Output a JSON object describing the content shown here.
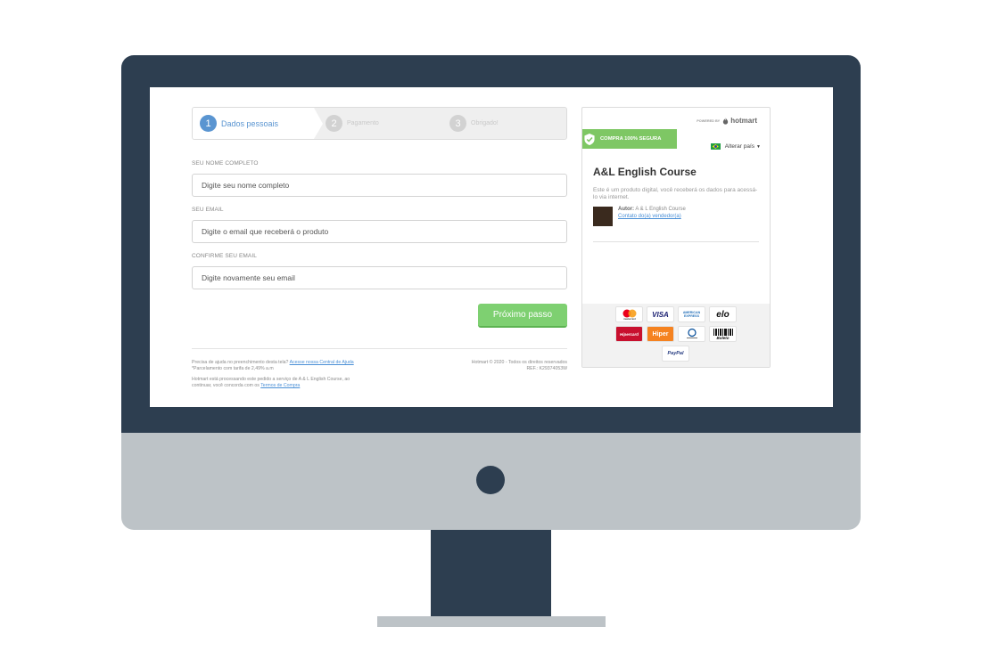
{
  "steps": [
    {
      "number": "1",
      "label": "Dados pessoais"
    },
    {
      "number": "2",
      "label": "Pagamento"
    },
    {
      "number": "3",
      "label": "Obrigado!"
    }
  ],
  "form": {
    "name": {
      "label": "SEU NOME COMPLETO",
      "placeholder": "Digite seu nome completo",
      "value": ""
    },
    "email": {
      "label": "SEU EMAIL",
      "placeholder": "Digite o email que receberá o produto",
      "value": ""
    },
    "confirm": {
      "label": "CONFIRME SEU EMAIL",
      "placeholder": "Digite novamente seu email",
      "value": ""
    },
    "next_button": "Próximo passo"
  },
  "footer": {
    "help_text": "Precisa de ajuda no preenchimento desta tela?",
    "help_link": "Acesse nossa Central de Ajuda",
    "installment_text": "*Parcelamento com tarifa de 2,49% a.m",
    "processing_text_1": "Hotmart está processando este pedido a serviço de A & L English Course, ao",
    "processing_text_2": "continuar, você concorda com os",
    "terms_link": "Termos de Compra",
    "copyright": "Hotmart © 2020 - Todos os direitos reservados",
    "ref": "REF.: K29374053W"
  },
  "product": {
    "powered_by": "POWERED BY",
    "brand": "hotmart",
    "secure_badge": "COMPRA 100% SEGURA",
    "change_country": "Alterar país",
    "title": "A&L English Course",
    "description": "Este é um produto digital, você receberá os dados para acessá-lo via internet.",
    "author_label": "Autor:",
    "author_name": "A & L English Course",
    "seller_contact": "Contato do(a) vendedor(a)"
  },
  "payment_methods": [
    "Mastercard",
    "VISA",
    "American Express",
    "elo",
    "Hipercard",
    "Hiper",
    "Diners Club",
    "Boleto",
    "PayPal"
  ],
  "payment_labels": {
    "mastercard": "mastercard",
    "visa": "VISA",
    "amex_1": "AMERICAN",
    "amex_2": "EXPRESS",
    "elo": "elo",
    "hipercard": "Hipercard",
    "hiper": "Hiper",
    "boleto": "Boleto",
    "paypal": "PayPal"
  },
  "colors": {
    "monitor_dark": "#2d3e50",
    "monitor_light": "#bdc3c7",
    "active_step": "#5a95d1",
    "button_green": "#7ed071",
    "badge_green": "#7ec764",
    "link_blue": "#4a8fd6"
  }
}
